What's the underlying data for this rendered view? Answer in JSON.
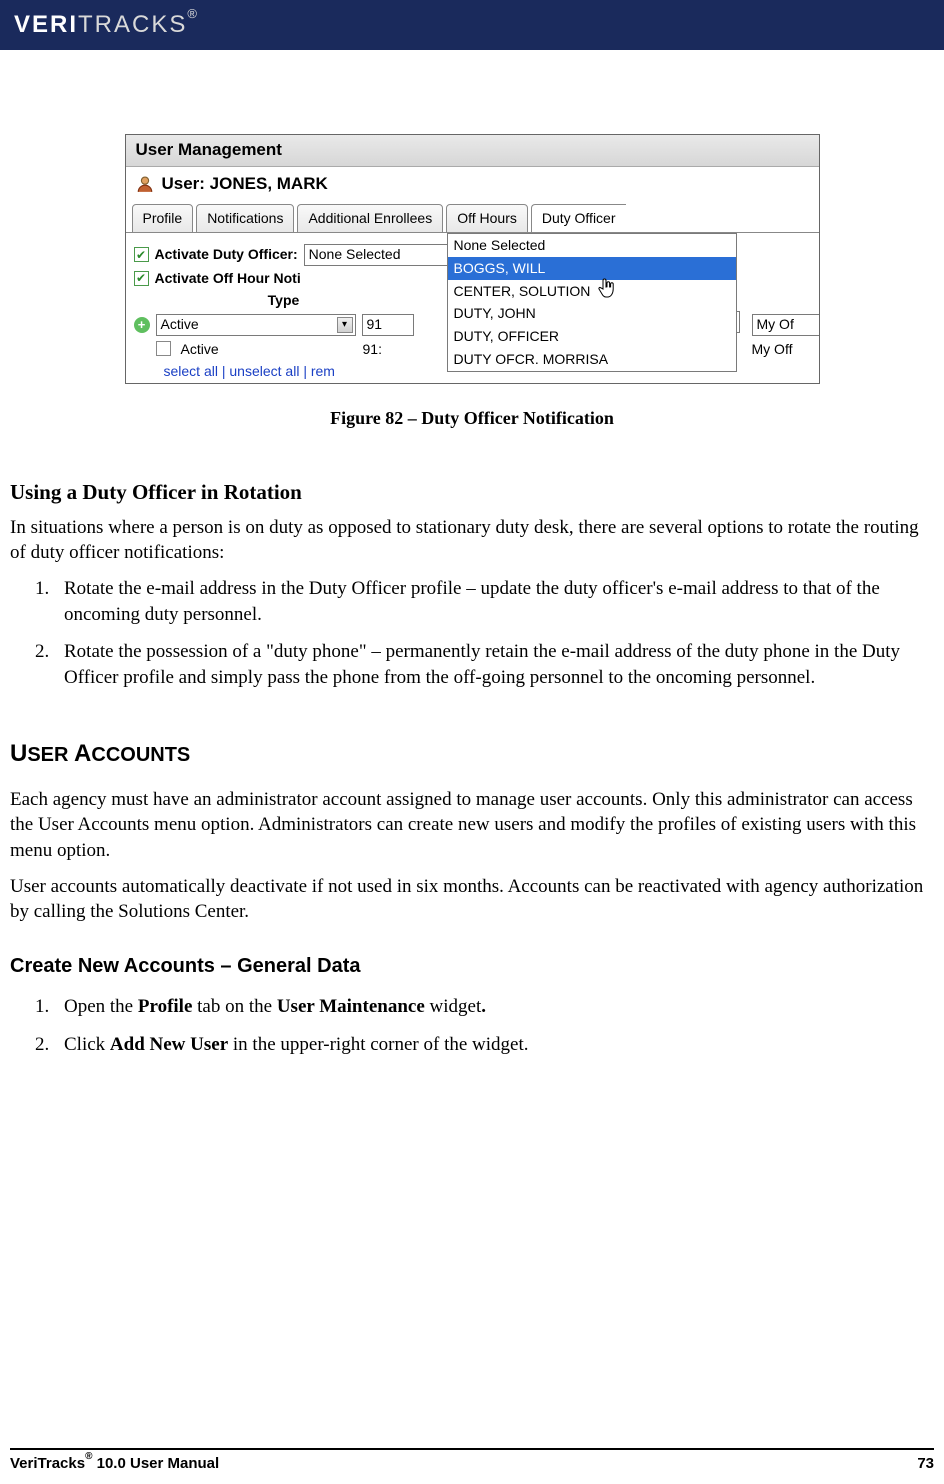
{
  "header": {
    "brand_prefix": "VERI",
    "brand_suffix": "TRACKS",
    "reg": "®"
  },
  "shot": {
    "titlebar": "User Management",
    "user_label": "User: JONES, MARK",
    "tabs": [
      "Profile",
      "Notifications",
      "Additional Enrollees",
      "Off Hours",
      "Duty Officer"
    ],
    "activate_duty_label": "Activate Duty Officer:",
    "activate_offhour_label": "Activate Off Hour Noti",
    "duty_selected": "None Selected",
    "dropdown_items": [
      "None Selected",
      "BOGGS, WILL",
      "CENTER, SOLUTION",
      "DUTY, JOHN",
      "DUTY, OFFICER",
      "DUTY OFCR. MORRISA"
    ],
    "dropdown_selected_index": 1,
    "type_header": "Type",
    "row1_type": "Active",
    "row1_val": "91",
    "row1_right": "My Of",
    "row2_type": "Active",
    "row2_val": "91:",
    "row2_right": "My Off",
    "links": {
      "select_all": "select all",
      "unselect_all": "unselect all",
      "rem": "rem"
    }
  },
  "caption": "Figure 82 – Duty Officer Notification",
  "section1": {
    "heading": "Using a Duty Officer in Rotation",
    "intro": "In situations where a person is on duty as opposed to stationary duty desk, there are several options to rotate the routing of duty officer notifications:",
    "items": [
      "Rotate the e-mail address in the Duty Officer profile – update the duty officer's e-mail address to that of the oncoming duty personnel.",
      "Rotate the possession of a \"duty phone\" – permanently retain the e-mail address of the duty phone in the Duty Officer profile and simply pass the phone from the off-going personnel to the oncoming personnel."
    ]
  },
  "section2": {
    "heading_first": "U",
    "heading_rest1": "SER ",
    "heading_first2": "A",
    "heading_rest2": "CCOUNTS",
    "p1": "Each agency must have an administrator account assigned to manage user accounts. Only this administrator can access the User Accounts menu option. Administrators can create new users and modify the profiles of existing users with this menu option.",
    "p2": "User accounts automatically deactivate if not used in six months. Accounts can be reactivated with agency authorization by calling the Solutions Center."
  },
  "section3": {
    "heading": "Create New Accounts – General Data",
    "step1_pre": "Open the ",
    "step1_b1": "Profile",
    "step1_mid": " tab on the ",
    "step1_b2": "User Maintenance",
    "step1_post": " widget",
    "step1_dot": ".",
    "step2_pre": "Click ",
    "step2_b": "Add New User",
    "step2_post": " in the upper-right corner of the widget."
  },
  "footer": {
    "left_brand": "VeriTracks",
    "left_sup": "®",
    "left_rest": " 10.0 User Manual",
    "page": "73"
  }
}
